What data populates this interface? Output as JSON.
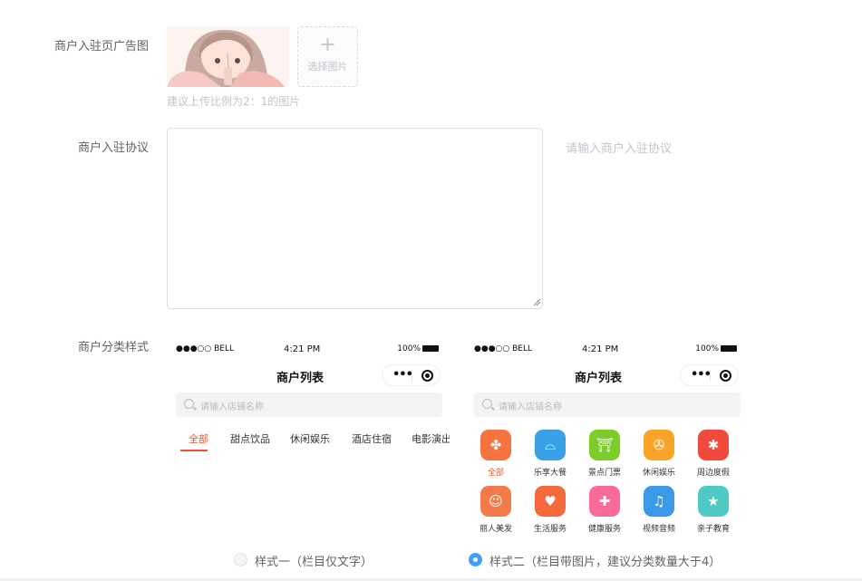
{
  "ad_image": {
    "label": "商户入驻页广告图",
    "upload_plus": "+",
    "upload_text": "选择图片",
    "hint": "建议上传比例为2：1的图片"
  },
  "agreement": {
    "label": "商户入驻协议",
    "placeholder": "请输入商户入驻协议",
    "value": ""
  },
  "category_style": {
    "label": "商户分类样式",
    "phone": {
      "carrier": "●●●○○ BELL",
      "time": "4:21 PM",
      "battery": "100%",
      "title": "商户列表",
      "search_placeholder": "请输入店铺名称"
    },
    "style1": {
      "tabs": [
        "全部",
        "甜点饮品",
        "休闲娱乐",
        "酒店住宿",
        "电影演出"
      ],
      "active_tab": "全部"
    },
    "style2": {
      "categories": [
        {
          "label": "全部",
          "color": "#f4733f",
          "icon": "grid-icon",
          "glyph": "✤"
        },
        {
          "label": "乐享大餐",
          "color": "#3aa0e8",
          "icon": "dish-cover-icon",
          "glyph": "⌓"
        },
        {
          "label": "景点门票",
          "color": "#7ccd2a",
          "icon": "landmark-icon",
          "glyph": "⛩"
        },
        {
          "label": "休闲娱乐",
          "color": "#f8a42a",
          "icon": "film-reel-icon",
          "glyph": "✇"
        },
        {
          "label": "周边度假",
          "color": "#f04a3c",
          "icon": "palm-tree-icon",
          "glyph": "✱"
        },
        {
          "label": "丽人美发",
          "color": "#f47a4a",
          "icon": "beauty-face-icon",
          "glyph": "☺"
        },
        {
          "label": "生活服务",
          "color": "#f46a3c",
          "icon": "hand-heart-icon",
          "glyph": "♥"
        },
        {
          "label": "健康服务",
          "color": "#f76a9a",
          "icon": "medical-kit-icon",
          "glyph": "✚"
        },
        {
          "label": "视频音频",
          "color": "#3a9ae8",
          "icon": "headphones-icon",
          "glyph": "♫"
        },
        {
          "label": "亲子教育",
          "color": "#4ec9c4",
          "icon": "parent-child-icon",
          "glyph": "★"
        }
      ],
      "active_category": "全部"
    },
    "options": [
      {
        "label": "样式一（栏目仅文字）",
        "checked": false
      },
      {
        "label": "样式二（栏目带图片，建议分类数量大于4）",
        "checked": true
      }
    ]
  },
  "colors": {
    "accent": "#409eff",
    "active_tab": "#f0562e"
  }
}
